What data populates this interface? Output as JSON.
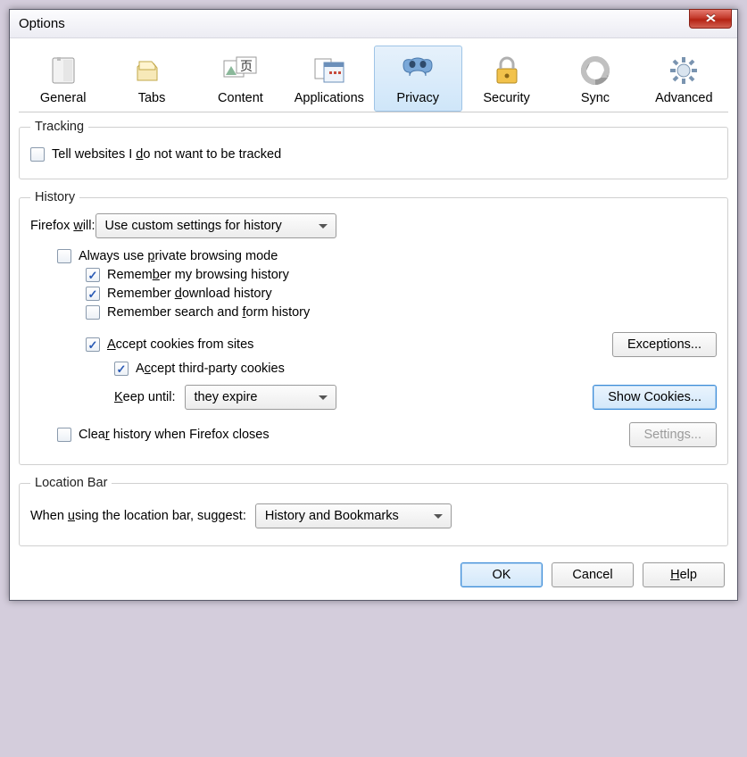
{
  "window": {
    "title": "Options"
  },
  "tabs": {
    "general": "General",
    "tabs": "Tabs",
    "content": "Content",
    "applications": "Applications",
    "privacy": "Privacy",
    "security": "Security",
    "sync": "Sync",
    "advanced": "Advanced",
    "selected": "privacy"
  },
  "tracking": {
    "legend": "Tracking",
    "tell_part1": "Tell websites I ",
    "tell_u": "d",
    "tell_part2": "o not want to be tracked",
    "tell_checked": false
  },
  "history": {
    "legend": "History",
    "firefox_will_part1": "Firefox ",
    "firefox_will_u": "w",
    "firefox_will_part2": "ill:",
    "mode_value": "Use custom settings for history",
    "always_private_part1": "Always use ",
    "always_private_u": "p",
    "always_private_part2": "rivate browsing mode",
    "always_private_checked": false,
    "remember_browsing_part1": "Remem",
    "remember_browsing_u": "b",
    "remember_browsing_part2": "er my browsing history",
    "remember_browsing_checked": true,
    "remember_download_part1": "Remember ",
    "remember_download_u": "d",
    "remember_download_part2": "ownload history",
    "remember_download_checked": true,
    "remember_form_part1": "Remember search and ",
    "remember_form_u": "f",
    "remember_form_part2": "orm history",
    "remember_form_checked": false,
    "accept_cookies_u": "A",
    "accept_cookies_part2": "ccept cookies from sites",
    "accept_cookies_checked": true,
    "exceptions_label": "Exceptions...",
    "accept_third_part1": "A",
    "accept_third_u": "c",
    "accept_third_part2": "cept third-party cookies",
    "accept_third_checked": true,
    "keep_until_u": "K",
    "keep_until_part2": "eep until:",
    "keep_until_value": "they expire",
    "show_cookies_label": "Show Cookies...",
    "clear_on_close_part1": "Clea",
    "clear_on_close_u": "r",
    "clear_on_close_part2": " history when Firefox closes",
    "clear_on_close_checked": false,
    "settings_label": "Settings..."
  },
  "location": {
    "legend": "Location Bar",
    "suggest_part1": "When ",
    "suggest_u": "u",
    "suggest_part2": "sing the location bar, suggest:",
    "suggest_value": "History and Bookmarks"
  },
  "footer": {
    "ok": "OK",
    "cancel": "Cancel",
    "help_u": "H",
    "help_part2": "elp"
  }
}
